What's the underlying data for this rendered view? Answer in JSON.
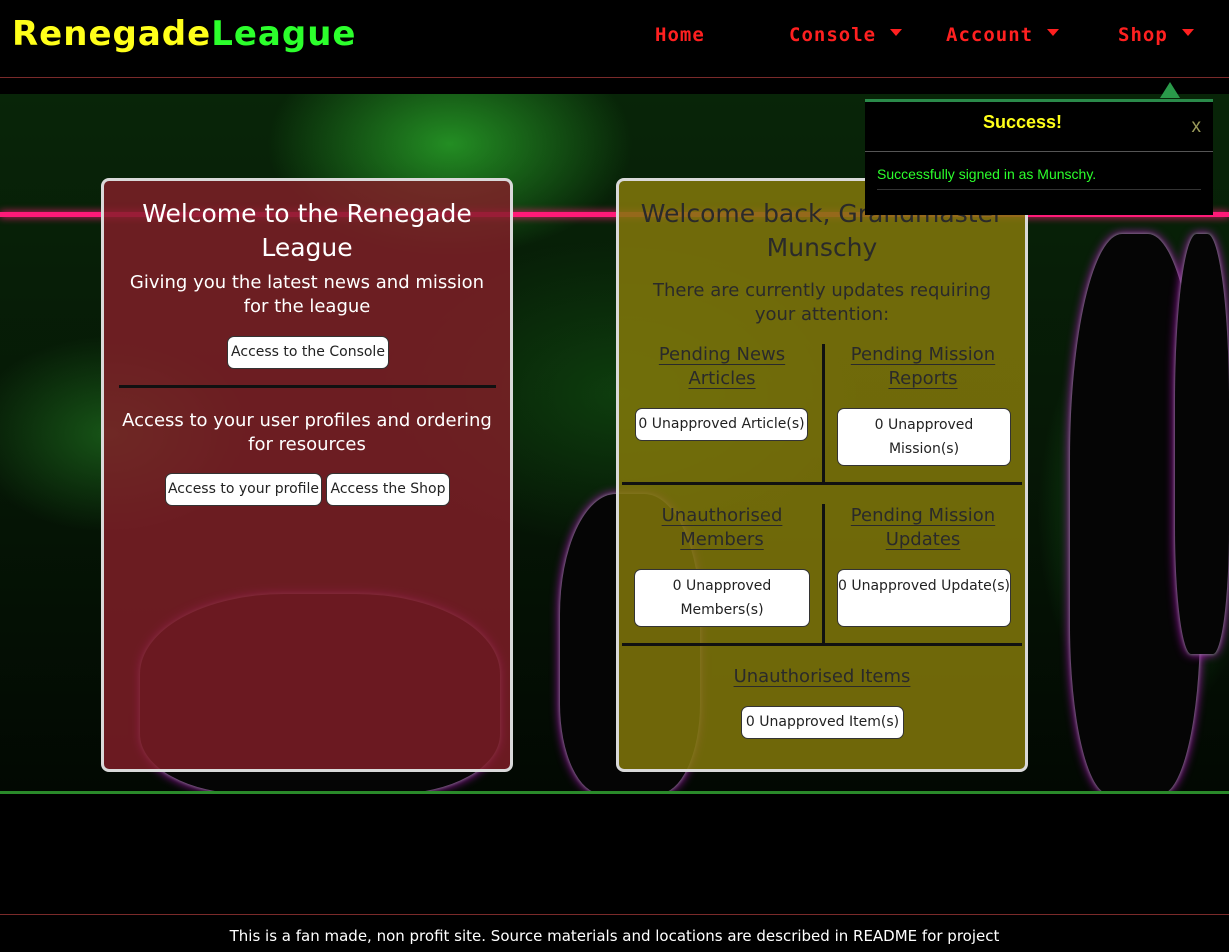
{
  "brand": {
    "part1": "RenegadeL",
    "part1_text": "Renegade",
    "part2": "League",
    "color1": "#ffff1a",
    "color2": "#2cff2c"
  },
  "nav": {
    "items": [
      {
        "label": "Home",
        "has_dropdown": false
      },
      {
        "label": "Console",
        "has_dropdown": true
      },
      {
        "label": "Account",
        "has_dropdown": true
      },
      {
        "label": "Shop",
        "has_dropdown": true
      }
    ],
    "color": "#ff2020"
  },
  "left_panel": {
    "title": "Welcome to the Renegade League",
    "subtitle": "Giving you the latest news and mission for the league",
    "console_button": "Access to the Console",
    "profiles_text": "Access to your user profiles and ordering for resources",
    "profile_button": "Access to your profile",
    "shop_button": "Access the Shop"
  },
  "right_panel": {
    "title": "Welcome back, Grandmaster Munschy",
    "subtitle": "There are currently updates requiring your attention:",
    "sections": {
      "news": {
        "title": "Pending News Articles",
        "button": "0 Unapproved Article(s)"
      },
      "missions": {
        "title": "Pending Mission Reports",
        "button": "0 Unapproved Mission(s)"
      },
      "members": {
        "title": "Unauthorised Members",
        "button": "0 Unapproved Members(s)"
      },
      "updates": {
        "title": "Pending Mission Updates",
        "button": "0 Unapproved Update(s)"
      },
      "items": {
        "title": "Unauthorised Items",
        "button": "0 Unapproved Item(s)"
      }
    }
  },
  "toast": {
    "title": "Success!",
    "close": "x",
    "message": "Successfully signed in as Munschy."
  },
  "footer": {
    "text": "This is a fan made, non profit site. Source materials and locations are described in README for project"
  }
}
